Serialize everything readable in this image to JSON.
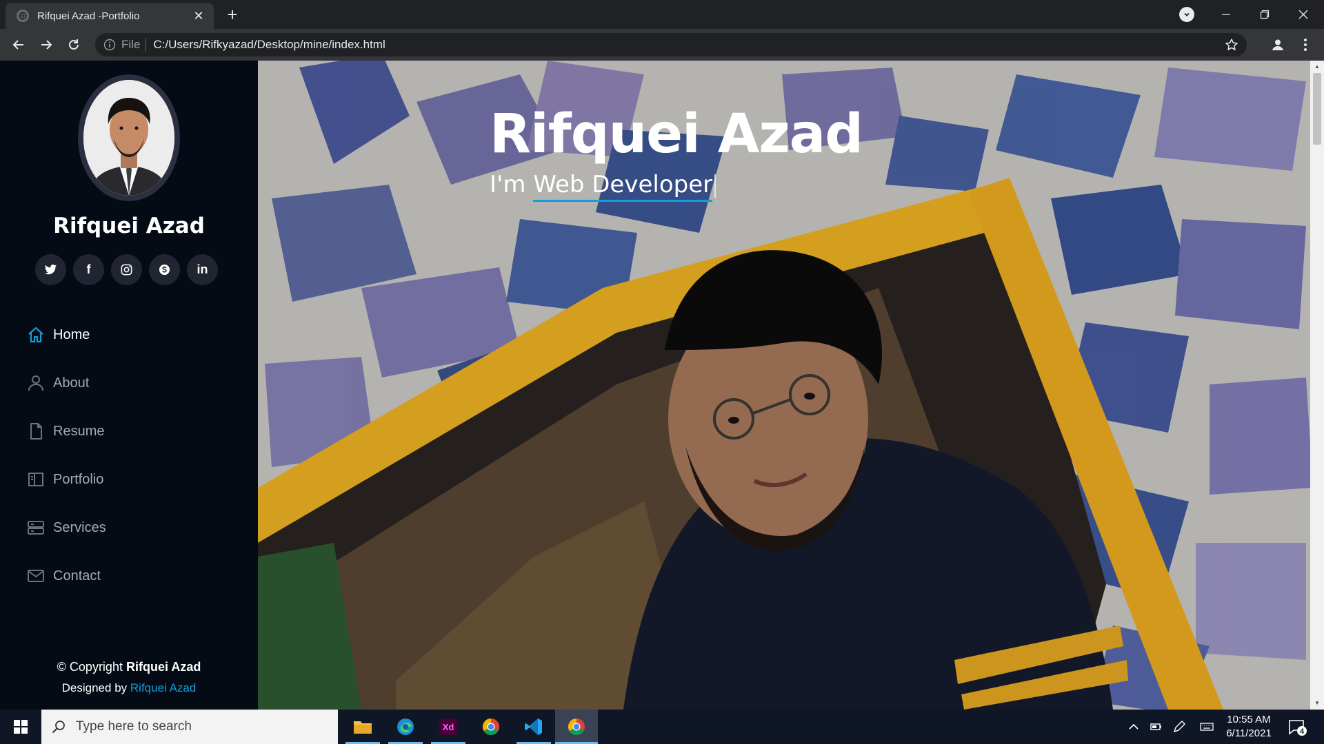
{
  "browser": {
    "tab_title": "Rifquei Azad -Portfolio",
    "tab_close": "✕",
    "new_tab": "+",
    "scheme": "File",
    "url": "C:/Users/Rifkyazad/Desktop/mine/index.html"
  },
  "sidebar": {
    "name": "Rifquei Azad",
    "socials": [
      "twitter-icon",
      "facebook-icon",
      "instagram-icon",
      "skype-icon",
      "linkedin-icon"
    ],
    "social_texts": {
      "facebook": "f",
      "linkedin": "in"
    },
    "nav": [
      {
        "label": "Home",
        "icon": "home-icon",
        "active": true
      },
      {
        "label": "About",
        "icon": "user-icon",
        "active": false
      },
      {
        "label": "Resume",
        "icon": "file-icon",
        "active": false
      },
      {
        "label": "Portfolio",
        "icon": "book-icon",
        "active": false
      },
      {
        "label": "Services",
        "icon": "server-icon",
        "active": false
      },
      {
        "label": "Contact",
        "icon": "envelope-icon",
        "active": false
      }
    ],
    "copyright_prefix": "© Copyright",
    "copyright_name": "Rifquei Azad",
    "designed_prefix": "Designed by",
    "designed_name": "Rifquei Azad"
  },
  "hero": {
    "title": "Rifquei Azad",
    "subtitle_prefix": "I'm",
    "subtitle_typed": "Web Developer"
  },
  "taskbar": {
    "search_placeholder": "Type here to search",
    "apps": [
      "file-explorer-icon",
      "edge-icon",
      "adobe-xd-icon",
      "chrome-icon",
      "vscode-icon",
      "chrome-icon"
    ],
    "xd_label": "Xd",
    "time": "10:55 AM",
    "date": "6/11/2021",
    "notification_count": "4"
  },
  "colors": {
    "sidebar_bg": "#040b14",
    "accent": "#149ddd",
    "social_bg": "#212431",
    "nav_text": "#a8a9b4"
  }
}
